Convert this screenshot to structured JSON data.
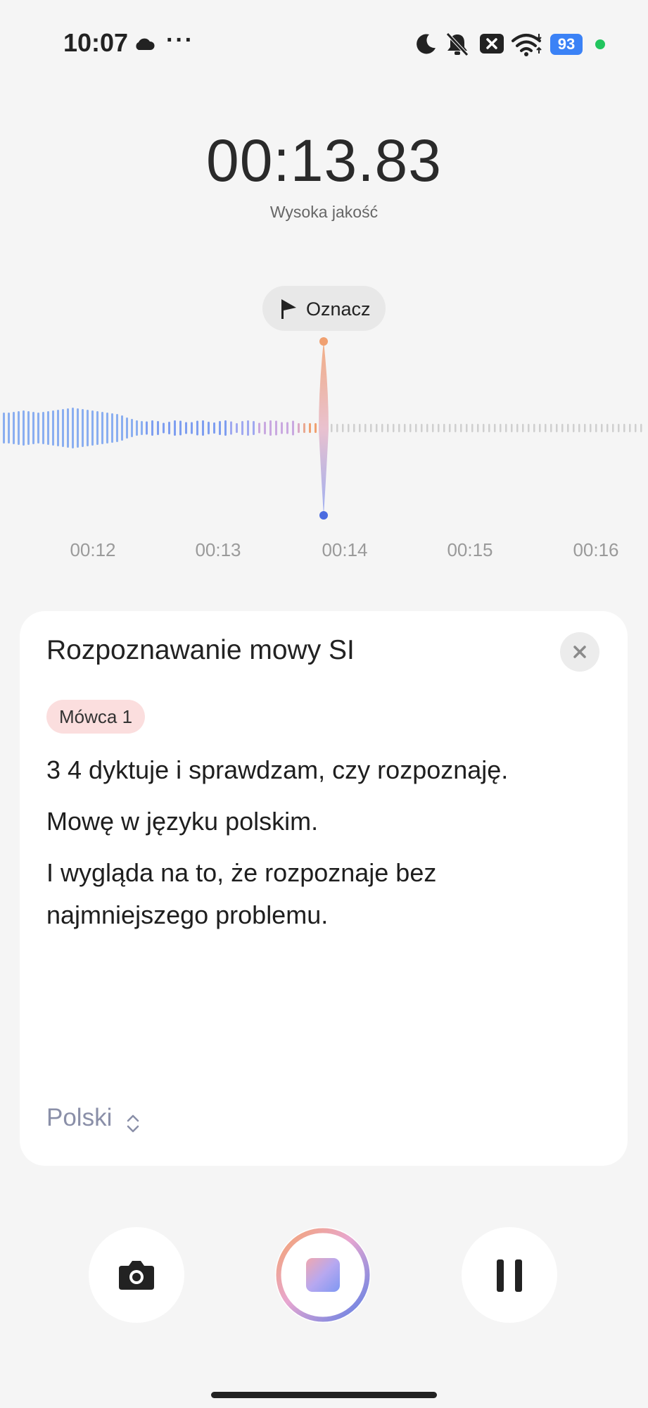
{
  "status_bar": {
    "time": "10:07",
    "more": "···",
    "battery": "93",
    "icons": [
      "cloud-icon",
      "moon-icon",
      "mute-icon",
      "sim-x-icon",
      "wifi-icon",
      "battery-icon",
      "privacy-dot"
    ]
  },
  "recorder": {
    "timer": "00:13.83",
    "quality": "Wysoka jakość",
    "mark_label": "Oznacz",
    "timeline": [
      "00:12",
      "00:13",
      "00:14",
      "00:15",
      "00:16"
    ]
  },
  "transcript_panel": {
    "title": "Rozpoznawanie mowy SI",
    "speaker": "Mówca 1",
    "lines": [
      "3 4 dyktuje i sprawdzam, czy rozpoznaję.",
      "Mowę w języku polskim.",
      "I wygląda na to, że rozpoznaje bez najmniejszego problemu."
    ],
    "language": "Polski"
  },
  "controls": {
    "icons": [
      "camera-icon",
      "stop-icon",
      "pause-icon"
    ]
  },
  "colors": {
    "accent_blue": "#5b7fe6",
    "accent_orange": "#f0a070",
    "speaker_badge": "#fbdede"
  }
}
